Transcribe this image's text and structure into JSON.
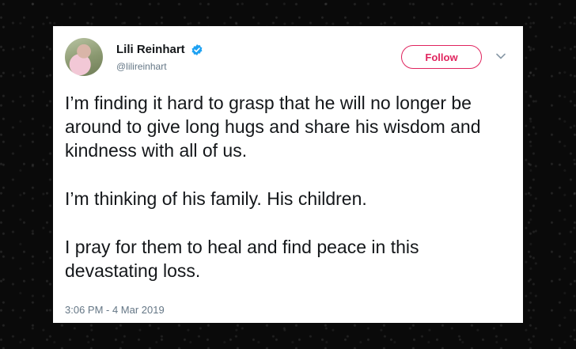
{
  "tweet": {
    "author": {
      "display_name": "Lili Reinhart",
      "handle": "@lilireinhart",
      "verified": true
    },
    "follow_label": "Follow",
    "paragraphs": [
      "I’m finding it hard to grasp that he will no longer be around to give long hugs and share his wisdom and kindness with all of us.",
      "I’m thinking of his family. His children.",
      "I pray for them to heal and find peace in this devastating loss."
    ],
    "timestamp": "3:06 PM - 4 Mar 2019"
  },
  "colors": {
    "follow_accent": "#e0245e",
    "verified_badge": "#1da1f2",
    "text_primary": "#14171a",
    "text_secondary": "#657786",
    "background": "#0a0a0a"
  },
  "icons": {
    "verified": "verified-badge-icon",
    "menu": "chevron-down-icon"
  }
}
